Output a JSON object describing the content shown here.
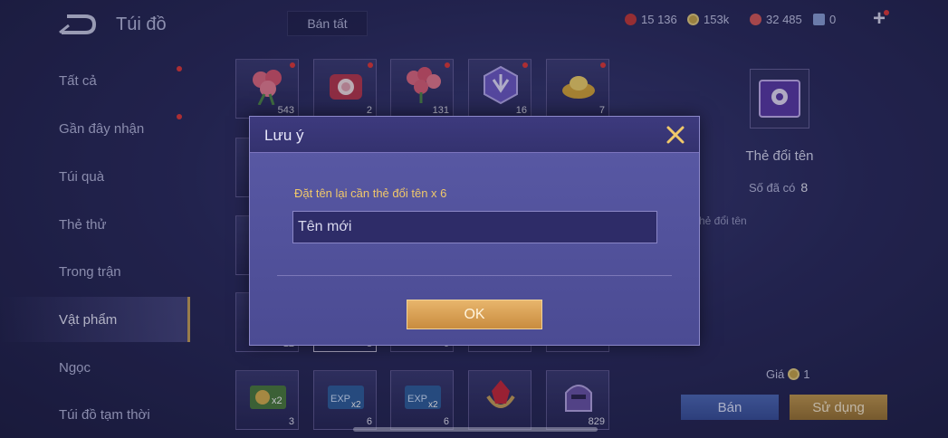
{
  "header": {
    "title": "Túi đồ",
    "sell_all_label": "Bán tất",
    "currencies": [
      {
        "icon": "ruby-icon",
        "value": "15 136",
        "color": "#c43a3a"
      },
      {
        "icon": "gold-coin-icon",
        "value": "153k",
        "color": "#c9a74a"
      },
      {
        "icon": "gem-icon",
        "value": "32 485",
        "color": "#d85a5a"
      },
      {
        "icon": "ticket-icon",
        "value": "0",
        "color": "#8aa0d8"
      }
    ]
  },
  "sidebar": {
    "items": [
      {
        "label": "Tất cả",
        "badge": true
      },
      {
        "label": "Gần đây nhận",
        "badge": true
      },
      {
        "label": "Túi quà",
        "badge": false
      },
      {
        "label": "Thẻ thử",
        "badge": false
      },
      {
        "label": "Trong trận",
        "badge": false
      },
      {
        "label": "Vật phẩm",
        "badge": false,
        "active": true
      },
      {
        "label": "Ngọc",
        "badge": false
      },
      {
        "label": "Túi đồ tạm thời",
        "badge": false
      }
    ]
  },
  "grid": {
    "row1": [
      {
        "icon": "rose-bouquet-icon",
        "qty": "543"
      },
      {
        "icon": "gift-box-icon",
        "qty": "2"
      },
      {
        "icon": "rose-bundle-icon",
        "qty": "131"
      },
      {
        "icon": "crystal-badge-icon",
        "qty": "16"
      },
      {
        "icon": "gold-ingot-icon",
        "qty": "7"
      }
    ],
    "row4": [
      {
        "icon": "coin-card-x2-icon",
        "qty": "3"
      },
      {
        "icon": "exp-card-x2-icon",
        "qty": "6"
      },
      {
        "icon": "exp-card-x2-icon",
        "qty": "6"
      },
      {
        "icon": "red-crystal-emblem-icon",
        "qty": ""
      },
      {
        "icon": "helmet-icon",
        "qty": "829"
      }
    ],
    "partial_qty": [
      "12",
      "8",
      "6"
    ]
  },
  "detail": {
    "name": "Thẻ đổi tên",
    "owned_label": "Số đã có",
    "owned_value": "8",
    "desc": "hẻ đổi tên",
    "price_label": "Giá",
    "price_value": "1",
    "sell_label": "Bán",
    "use_label": "Sử dụng"
  },
  "modal": {
    "title": "Lưu ý",
    "prompt": "Đặt tên lại cần thẻ đổi tên x 6",
    "input_placeholder": "Tên mới",
    "input_value": "",
    "ok_label": "OK"
  }
}
